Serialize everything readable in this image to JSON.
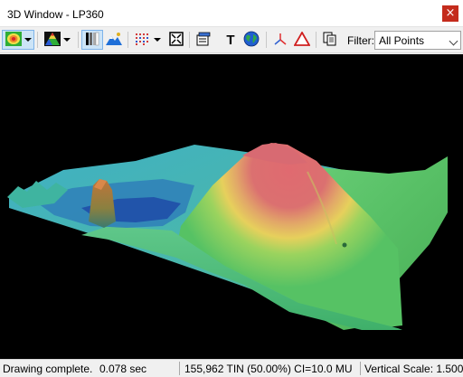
{
  "window": {
    "title": "3D Window - LP360",
    "close_glyph": "×"
  },
  "toolbar": {
    "buttons": [
      {
        "name": "color-by-elevation-icon",
        "dropdown": true,
        "pressed": true
      },
      {
        "name": "tin-color-ramp-icon",
        "dropdown": true
      },
      {
        "name": "grayscale-shading-icon",
        "pressed": true
      },
      {
        "name": "hillshade-icon"
      },
      {
        "name": "point-display-icon",
        "dropdown": true
      },
      {
        "name": "fit-extent-icon"
      },
      {
        "name": "properties-icon"
      },
      {
        "name": "text-label-icon"
      },
      {
        "name": "globe-icon"
      },
      {
        "name": "axes-icon"
      },
      {
        "name": "profile-triangle-icon"
      },
      {
        "name": "copy-icon"
      }
    ],
    "text_tool_glyph": "T",
    "filter_label": "Filter:",
    "filter_value": "All Points"
  },
  "status": {
    "message": "Drawing complete.",
    "time": "0.078 sec",
    "tin_info": "155,962 TIN (50.00%) CI=10.0 MU",
    "vertical_scale": "Vertical Scale: 1.5000"
  },
  "colors": {
    "peak": "#d9646a",
    "high": "#e8c55a",
    "mid": "#5fcf6d",
    "low": "#39a9bd",
    "water": "#1f4fa8",
    "close_button": "#c42b1c",
    "pressed_button": "#cce4f7"
  }
}
